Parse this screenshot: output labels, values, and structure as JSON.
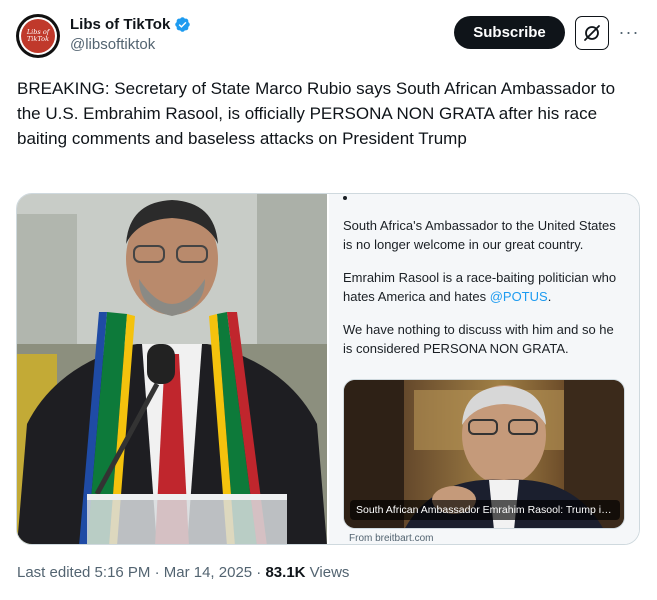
{
  "author": {
    "display_name": "Libs of TikTok",
    "handle": "@libsoftiktok",
    "avatar_text_line1": "Libs of",
    "avatar_text_line2": "TikTok"
  },
  "header": {
    "subscribe_label": "Subscribe",
    "more_label": "···"
  },
  "tweet": {
    "text": "BREAKING: Secretary of State Marco Rubio says South African Ambassador to the U.S. Embrahim Rasool, is officially PERSONA NON GRATA after his race baiting comments and baseless attacks on President Trump"
  },
  "embedded_post": {
    "para1": "South Africa's Ambassador to the United States is no longer welcome in our great country.",
    "para2_before": "Emrahim Rasool is a race-baiting politician who hates America and hates ",
    "para2_mention": "@POTUS",
    "para2_after": ".",
    "para3": "We have nothing to discuss with him and so he is considered PERSONA NON GRATA.",
    "card_caption": "South African Ambassador Emrahim Rasool: Trump is Leadi...",
    "card_source": "From breitbart.com"
  },
  "meta": {
    "edited": "Last edited 5:16 PM · Mar 14, 2025 · ",
    "views_count": "83.1K",
    "views_label": " Views"
  },
  "colors": {
    "link": "#1d9bf0",
    "verified": "#1d9bf0",
    "text_primary": "#0f1419",
    "text_secondary": "#536471"
  },
  "icons": {
    "verified": "verified-badge-icon",
    "grok": "grok-icon",
    "more": "more-options-icon"
  }
}
